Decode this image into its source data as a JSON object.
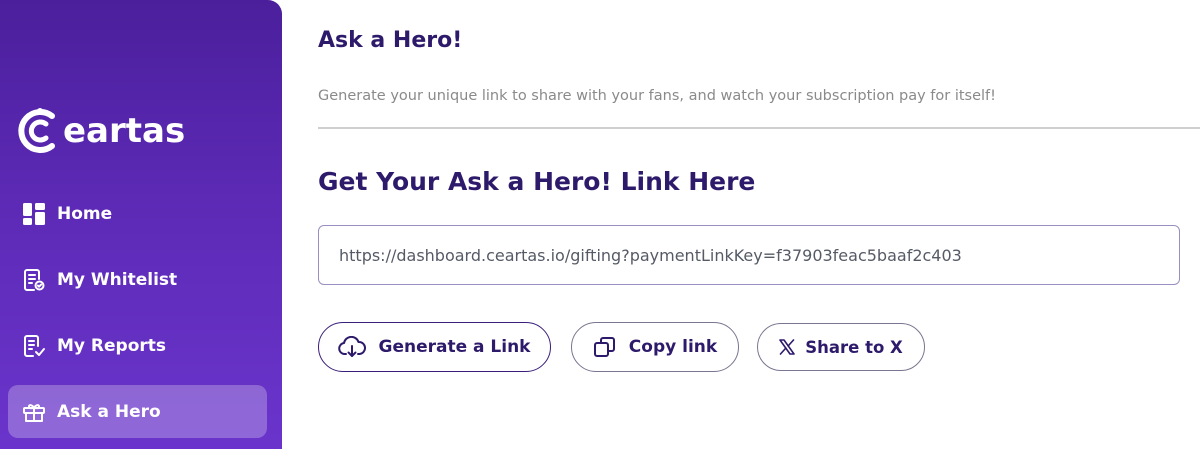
{
  "sidebar": {
    "logo_text": "eartas",
    "items": [
      {
        "label": "Home",
        "icon": "dashboard-grid-icon",
        "active": false
      },
      {
        "label": "My Whitelist",
        "icon": "document-check-icon",
        "active": false
      },
      {
        "label": "My Reports",
        "icon": "report-checkmark-icon",
        "active": false
      },
      {
        "label": "Ask a Hero",
        "icon": "gift-icon",
        "active": true
      }
    ]
  },
  "main": {
    "title": "Ask a Hero!",
    "subtitle": "Generate your unique link to share with your fans, and watch your subscription pay for itself!",
    "section_title": "Get Your Ask a Hero! Link Here",
    "link_value": "https://dashboard.ceartas.io/gifting?paymentLinkKey=f37903feac5baaf2c403",
    "buttons": {
      "generate": {
        "label": "Generate a Link",
        "icon": "cloud-download-icon"
      },
      "copy": {
        "label": "Copy link",
        "icon": "copy-icon"
      },
      "share": {
        "label": "Share to X",
        "icon": "x-logo-icon"
      }
    }
  },
  "colors": {
    "sidebar_top": "#4b1f9c",
    "sidebar_bottom": "#6a34cc",
    "heading": "#2e1a6b",
    "muted_text": "#8a8a8a"
  }
}
